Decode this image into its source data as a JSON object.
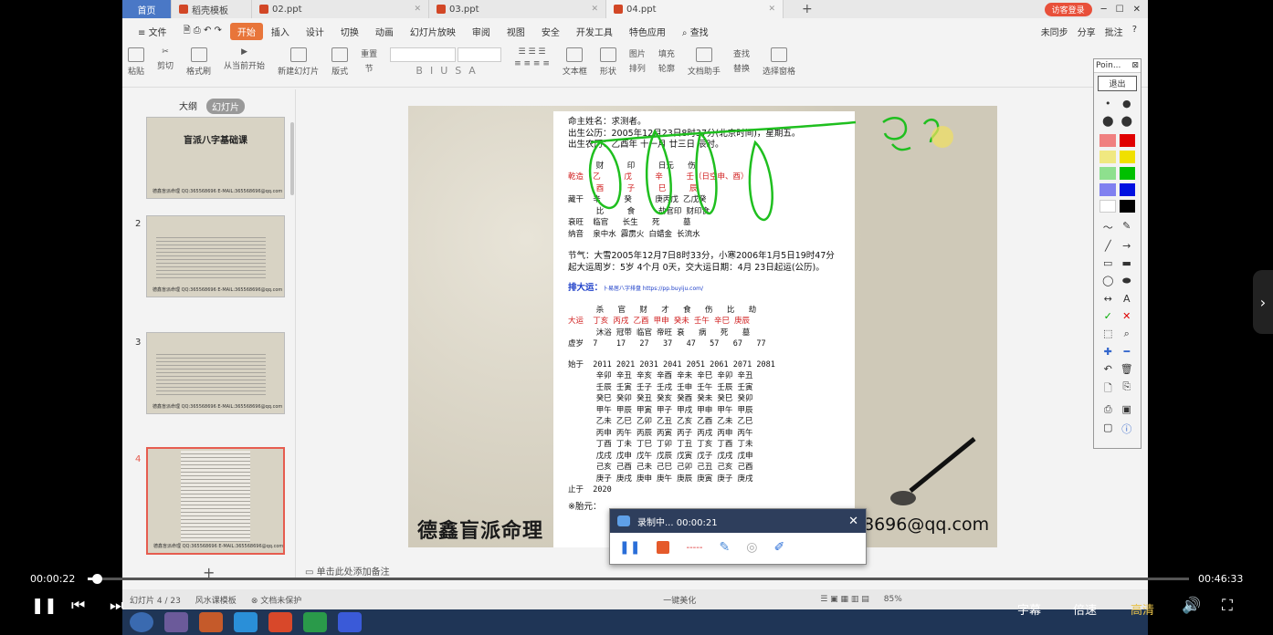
{
  "tabs": {
    "home": "首页",
    "t1": "稻壳模板",
    "t2": "02.ppt",
    "t3": "03.ppt",
    "t4": "04.ppt",
    "login": "访客登录"
  },
  "menu": {
    "file": "文件",
    "start": "开始",
    "insert": "插入",
    "design": "设计",
    "switch": "切换",
    "anim": "动画",
    "show": "幻灯片放映",
    "review": "审阅",
    "view": "视图",
    "safe": "安全",
    "dev": "开发工具",
    "special": "特色应用",
    "search": "查找",
    "sync": "未同步",
    "share": "分享",
    "comment": "批注"
  },
  "ribbon": {
    "paste": "粘贴",
    "cut": "剪切",
    "copy": "复制",
    "painter": "格式刷",
    "play": "从当前开始",
    "newslide": "新建幻灯片",
    "layout": "版式",
    "section": "节",
    "reset": "重置",
    "textbox": "文本框",
    "shape": "形状",
    "arrange": "排列",
    "image": "图片",
    "fill": "填充",
    "outline": "轮廓",
    "assistant": "文档助手",
    "find": "查找",
    "replace": "替换",
    "selectpane": "选择窗格"
  },
  "panel": {
    "outline": "大纲",
    "slides": "幻灯片",
    "n2": "2",
    "n3": "3",
    "n4": "4",
    "thumb_title": "盲派八字基础课",
    "thumb_foot": "德鑫盲派命理  QQ:365568696  E-MAIL:365568696@qq.com"
  },
  "slide": {
    "name": "命主姓名：求测者。",
    "solar": "出生公历：2005年12月23日8时37分(北京时间)，星期五。",
    "lunar": "出生农历：乙酉年 十一月 廿三日 辰时。",
    "r1": "      财     印     日元   伤",
    "r2": "乾造  乙     戊     辛     壬（日空申、酉）",
    "r3": "      酉     子     巳     辰",
    "r4": "藏干  辛     癸     庚丙戊 乙戊癸",
    "r5": "      比     食     劫官印 财印食",
    "r6": "衰旺  临官   长生   死     墓",
    "r7": "纳音  泉中水 霹雳火 白蜡金 长流水",
    "jq1": "节气：大雪2005年12月7日8时33分，小寒2006年1月5日19时47分",
    "jq2": "起大运周岁：5岁 4个月 0天，交大运日期：4月 23日起运(公历)。",
    "dy_label": "排大运：",
    "dy_link": "卜易居八字排盘 https://pp.buyiju.com/",
    "d1": "      杀   官   财   才   食   伤   比   劫",
    "d2": "大运  丁亥 丙戌 乙酉 甲申 癸未 壬午 辛巳 庚辰",
    "d3": "      沐浴 冠带 临官 帝旺 衰   病   死   墓",
    "d4": "虚岁  7    17   27   37   47   57   67   77",
    "y0": "始于  2011 2021 2031 2041 2051 2061 2071 2081",
    "y1": "      辛卯 辛丑 辛亥 辛酉 辛未 辛巳 辛卯 辛丑",
    "y2": "      壬辰 壬寅 壬子 壬戌 壬申 壬午 壬辰 壬寅",
    "y3": "      癸巳 癸卯 癸丑 癸亥 癸酉 癸未 癸巳 癸卯",
    "y4": "      甲午 甲辰 甲寅 甲子 甲戌 甲申 甲午 甲辰",
    "y5": "      乙未 乙巳 乙卯 乙丑 乙亥 乙酉 乙未 乙巳",
    "y6": "      丙申 丙午 丙辰 丙寅 丙子 丙戌 丙申 丙午",
    "y7": "      丁酉 丁未 丁巳 丁卯 丁丑 丁亥 丁酉 丁未",
    "y8": "      戊戌 戊申 戊午 戊辰 戊寅 戊子 戊戌 戊申",
    "y9": "      己亥 己酉 己未 己巳 己卯 己丑 己亥 己酉",
    "y10": "      庚子 庚戌 庚申 庚午 庚辰 庚寅 庚子 庚戌",
    "end": "止于  2020",
    "note": "※胎元：",
    "watermark": "德鑫盲派命理",
    "email": "8696@qq.com"
  },
  "recorder": {
    "status": "录制中... 00:00:21"
  },
  "notes": "单击此处添加备注",
  "status": {
    "page": "幻灯片 4 / 23",
    "theme": "风水课模板",
    "protect": "文档未保护",
    "beautify": "一键美化",
    "zoom": "85%"
  },
  "pointer": {
    "title": "Poin...",
    "exit": "退出"
  },
  "player": {
    "current": "00:00:22",
    "total": "00:46:33",
    "progress": 0.008,
    "subtitle": "字幕",
    "speed": "倍速",
    "quality": "高清"
  },
  "colors": {
    "accent": "#e8753a",
    "red": "#d01d1d",
    "green": "#1fbf1f",
    "blue": "#1a3cc8"
  }
}
